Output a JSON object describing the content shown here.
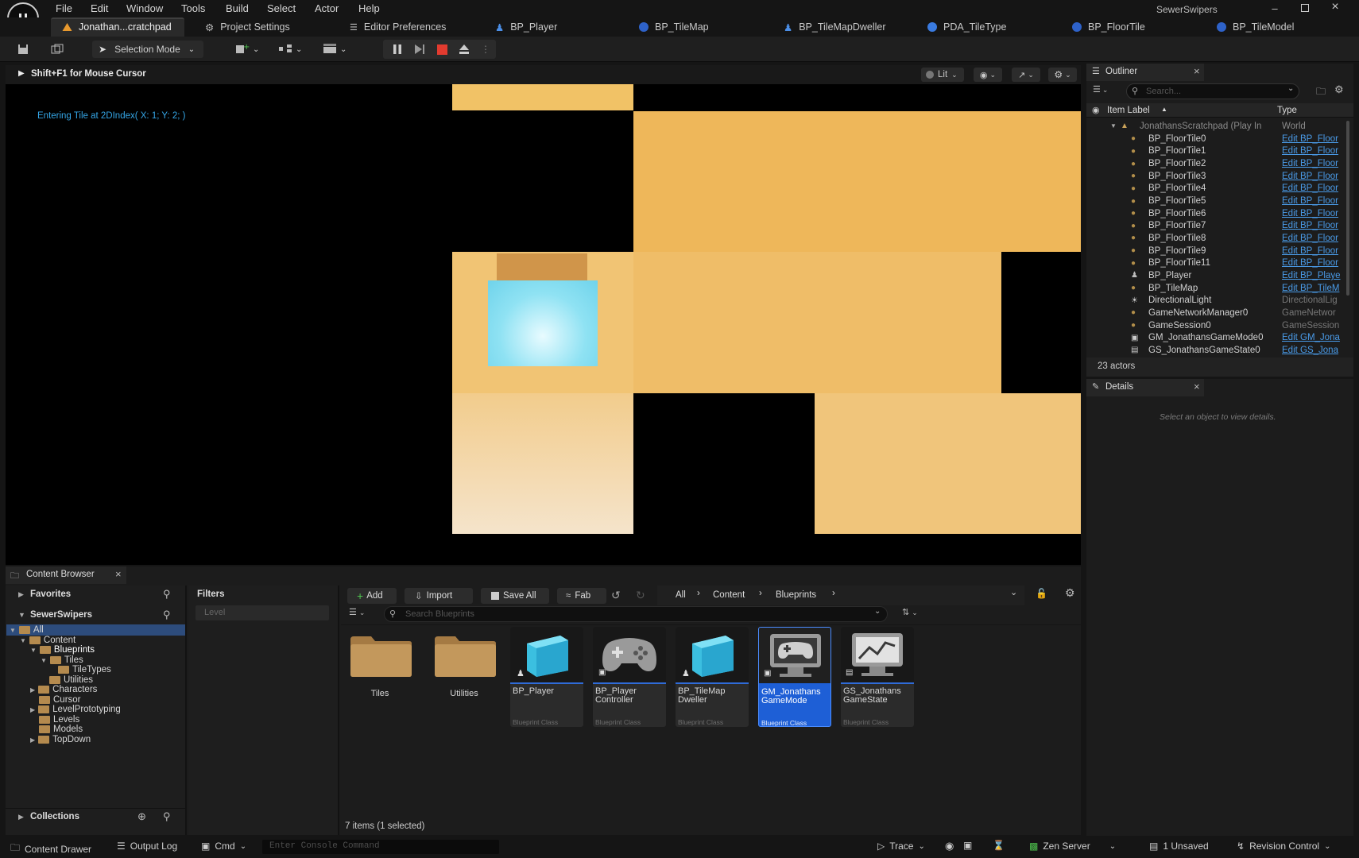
{
  "app": {
    "project_title": "SewerSwipers",
    "menu": [
      "File",
      "Edit",
      "Window",
      "Tools",
      "Build",
      "Select",
      "Actor",
      "Help"
    ]
  },
  "doc_tabs": [
    {
      "label": "Jonathan...cratchpad",
      "icon": "level-warning-icon"
    },
    {
      "label": "Project Settings",
      "icon": "gear-icon"
    },
    {
      "label": "Editor Preferences",
      "icon": "sliders-icon"
    },
    {
      "label": "BP_Player",
      "icon": "pawn-blueprint-icon"
    },
    {
      "label": "BP_TileMap",
      "icon": "blueprint-icon"
    },
    {
      "label": "BP_TileMapDweller",
      "icon": "pawn-blueprint-icon"
    },
    {
      "label": "PDA_TileType",
      "icon": "data-asset-icon"
    },
    {
      "label": "BP_FloorTile",
      "icon": "blueprint-icon"
    },
    {
      "label": "BP_TileModel",
      "icon": "blueprint-icon"
    }
  ],
  "toolbar": {
    "mode_label": "Selection Mode"
  },
  "viewport": {
    "hint": "Shift+F1 for Mouse Cursor",
    "lit_label": "Lit",
    "debug_message": "Entering Tile at 2DIndex( X: 1; Y: 2; )"
  },
  "outliner": {
    "title": "Outliner",
    "search_placeholder": "Search...",
    "col_label": "Item Label",
    "col_type": "Type",
    "root": {
      "label": "JonathansScratchpad (Play In",
      "type": "World"
    },
    "rows": [
      {
        "label": "BP_FloorTile0",
        "type": "Edit BP_Floor",
        "link": true,
        "icon": "actor-icon"
      },
      {
        "label": "BP_FloorTile1",
        "type": "Edit BP_Floor",
        "link": true,
        "icon": "actor-icon"
      },
      {
        "label": "BP_FloorTile2",
        "type": "Edit BP_Floor",
        "link": true,
        "icon": "actor-icon"
      },
      {
        "label": "BP_FloorTile3",
        "type": "Edit BP_Floor",
        "link": true,
        "icon": "actor-icon"
      },
      {
        "label": "BP_FloorTile4",
        "type": "Edit BP_Floor",
        "link": true,
        "icon": "actor-icon"
      },
      {
        "label": "BP_FloorTile5",
        "type": "Edit BP_Floor",
        "link": true,
        "icon": "actor-icon"
      },
      {
        "label": "BP_FloorTile6",
        "type": "Edit BP_Floor",
        "link": true,
        "icon": "actor-icon"
      },
      {
        "label": "BP_FloorTile7",
        "type": "Edit BP_Floor",
        "link": true,
        "icon": "actor-icon"
      },
      {
        "label": "BP_FloorTile8",
        "type": "Edit BP_Floor",
        "link": true,
        "icon": "actor-icon"
      },
      {
        "label": "BP_FloorTile9",
        "type": "Edit BP_Floor",
        "link": true,
        "icon": "actor-icon"
      },
      {
        "label": "BP_FloorTile11",
        "type": "Edit BP_Floor",
        "link": true,
        "icon": "actor-icon"
      },
      {
        "label": "BP_Player",
        "type": "Edit BP_Playe",
        "link": true,
        "icon": "pawn-icon"
      },
      {
        "label": "BP_TileMap",
        "type": "Edit BP_TileM",
        "link": true,
        "icon": "actor-icon"
      },
      {
        "label": "DirectionalLight",
        "type": "DirectionalLig",
        "link": false,
        "icon": "sun-icon"
      },
      {
        "label": "GameNetworkManager0",
        "type": "GameNetwor",
        "link": false,
        "icon": "actor-icon"
      },
      {
        "label": "GameSession0",
        "type": "GameSession",
        "link": false,
        "icon": "actor-icon"
      },
      {
        "label": "GM_JonathansGameMode0",
        "type": "Edit GM_Jona",
        "link": true,
        "icon": "gamemode-icon"
      },
      {
        "label": "GS_JonathansGameState0",
        "type": "Edit GS_Jona",
        "link": true,
        "icon": "gamestate-icon"
      }
    ],
    "actor_count": "23 actors"
  },
  "details": {
    "title": "Details",
    "empty_message": "Select an object to view details."
  },
  "content_browser": {
    "tab_label": "Content Browser",
    "favorites_label": "Favorites",
    "project_label": "SewerSwipers",
    "filters_label": "Filters",
    "filter_chip": "Level",
    "add_label": "Add",
    "import_label": "Import",
    "save_all_label": "Save All",
    "fab_label": "Fab",
    "breadcrumb": [
      "All",
      "Content",
      "Blueprints"
    ],
    "search_placeholder": "Search Blueprints",
    "tree": [
      "All",
      "Content",
      "Blueprints",
      "Tiles",
      "TileTypes",
      "Utilities",
      "Characters",
      "Cursor",
      "LevelPrototyping",
      "Levels",
      "Models",
      "TopDown"
    ],
    "collections_label": "Collections",
    "folders": [
      "Tiles",
      "Utilities"
    ],
    "assets": [
      {
        "name": "BP_Player",
        "cls": "Blueprint Class",
        "thumb": "cube",
        "selected": false
      },
      {
        "name": "BP_Player Controller",
        "cls": "Blueprint Class",
        "thumb": "gamepad",
        "selected": false
      },
      {
        "name": "BP_TileMap Dweller",
        "cls": "Blueprint Class",
        "thumb": "cube",
        "selected": false
      },
      {
        "name": "GM_Jonathans GameMode",
        "cls": "Blueprint Class",
        "thumb": "monitor-gamepad",
        "selected": true
      },
      {
        "name": "GS_Jonathans GameState",
        "cls": "Blueprint Class",
        "thumb": "monitor-chart",
        "selected": false
      }
    ],
    "item_count": "7 items (1 selected)"
  },
  "statusbar": {
    "content_drawer": "Content Drawer",
    "output_log": "Output Log",
    "cmd": "Cmd",
    "console_placeholder": "Enter Console Command",
    "trace": "Trace",
    "zen_server": "Zen Server",
    "unsaved": "1 Unsaved",
    "revision_control": "Revision Control"
  },
  "colors": {
    "accent": "#2f6bd8",
    "link": "#4a9be8",
    "tile": "#efb85c",
    "player_cube": "#7fe0f2",
    "stop_button": "#e33b2f"
  }
}
